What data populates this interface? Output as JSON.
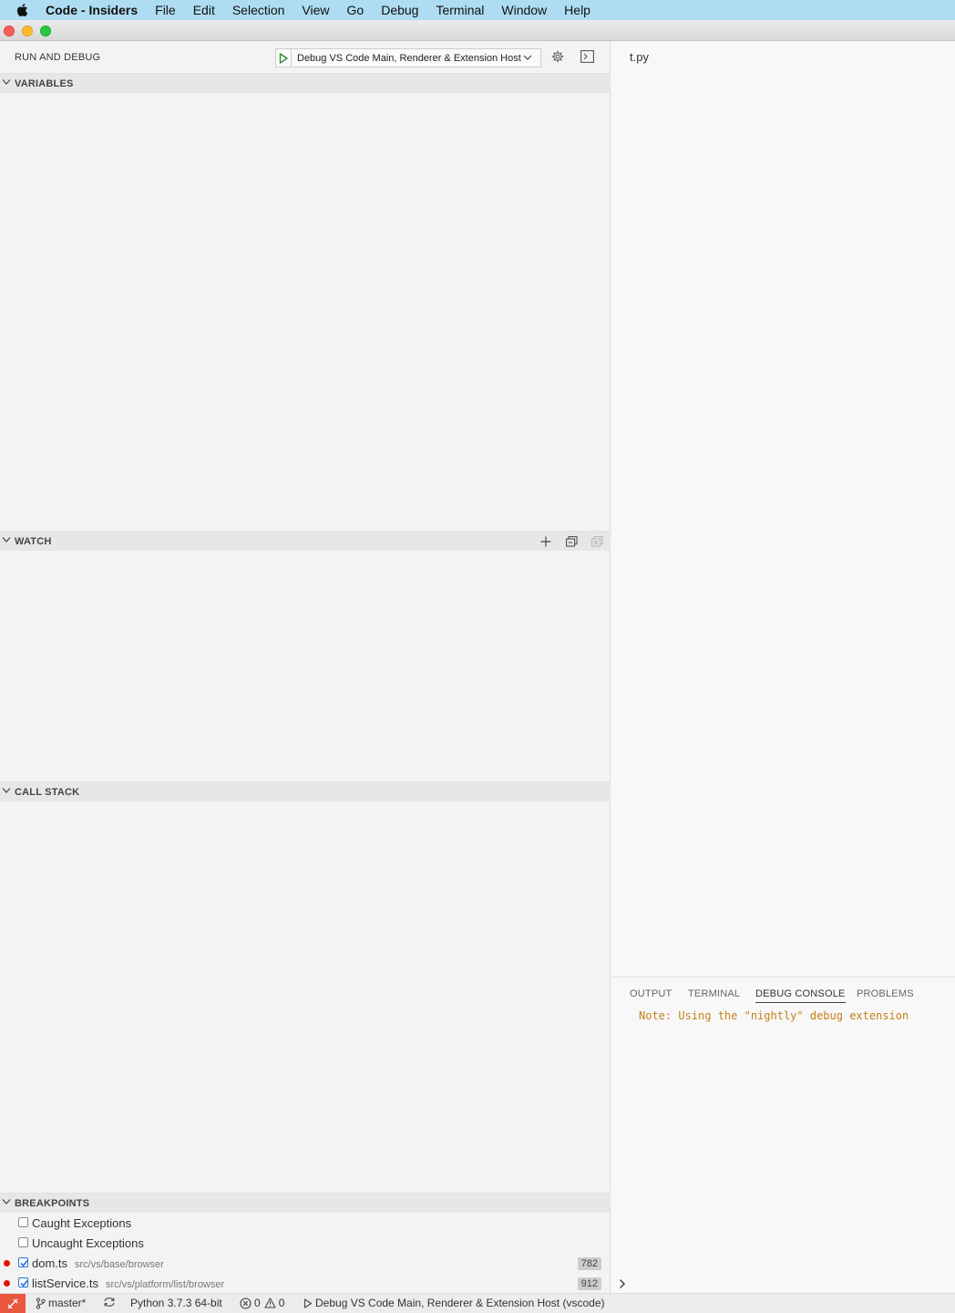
{
  "menubar": {
    "app_name": "Code - Insiders",
    "items": [
      "File",
      "Edit",
      "Selection",
      "View",
      "Go",
      "Debug",
      "Terminal",
      "Window",
      "Help"
    ]
  },
  "sidebar": {
    "title": "RUN AND DEBUG",
    "launch_config": "Debug VS Code Main, Renderer & Extension Host",
    "sections": {
      "variables": "VARIABLES",
      "watch": "WATCH",
      "call_stack": "CALL STACK",
      "breakpoints": "BREAKPOINTS"
    },
    "breakpoints": [
      {
        "label": "Caught Exceptions",
        "checked": false
      },
      {
        "label": "Uncaught Exceptions",
        "checked": false
      },
      {
        "label": "dom.ts",
        "path": "src/vs/base/browser",
        "line": "782",
        "checked": true
      },
      {
        "label": "listService.ts",
        "path": "src/vs/platform/list/browser",
        "line": "912",
        "checked": true
      }
    ]
  },
  "editor": {
    "file": "t.py"
  },
  "panel": {
    "tabs": [
      "OUTPUT",
      "TERMINAL",
      "DEBUG CONSOLE",
      "PROBLEMS"
    ],
    "active_tab": "DEBUG CONSOLE",
    "console_line": "Note: Using the \"nightly\" debug extension"
  },
  "statusbar": {
    "branch": "master*",
    "python": "Python 3.7.3 64-bit",
    "errors": "0",
    "warnings": "0",
    "debug_target": "Debug VS Code Main, Renderer & Extension Host (vscode)"
  },
  "colors": {
    "menubar": "#aedcf0",
    "breakpoint": "#e51400",
    "console_note": "#c5801a",
    "remote_indicator": "#e9573f",
    "play_green": "#388a34"
  }
}
